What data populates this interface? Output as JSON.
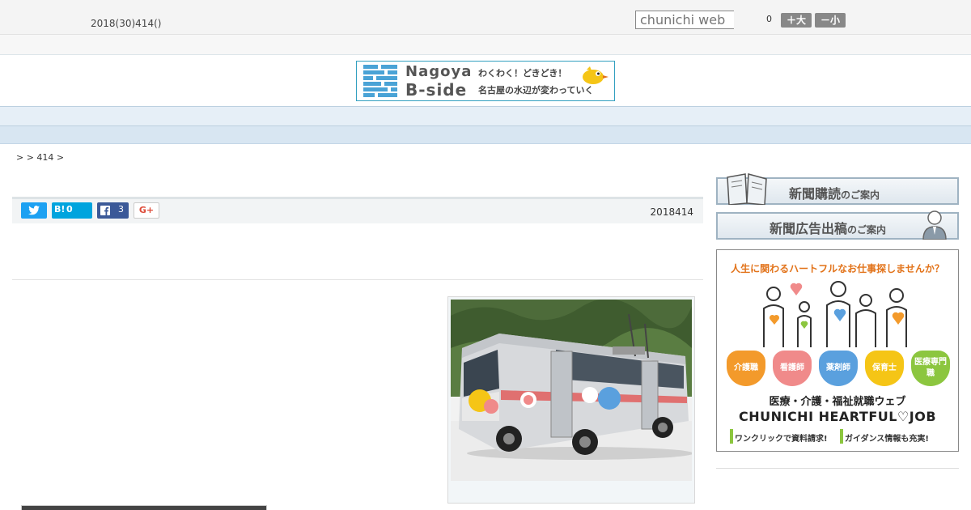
{
  "header": {
    "date": "2018(30)414()",
    "search_placeholder": "chunichi web",
    "font_count": "0",
    "font_bigger": "＋大",
    "font_smaller": "－小"
  },
  "banner": {
    "line1": "Nagoya",
    "line2": "B-side",
    "jp_line1": "わくわく！どきどき！",
    "jp_line2": "名古屋の水辺が変わっていく"
  },
  "nav": {
    "items": [
      "",
      "",
      "",
      "",
      "",
      "",
      "",
      "",
      ""
    ]
  },
  "breadcrumb": ">  > 414 >",
  "share": {
    "hatena_label": "B!",
    "hatena_count": "0",
    "facebook_count": "3",
    "google_label": "G+",
    "article_date": "2018414"
  },
  "sidebar": {
    "subscribe_main": "新聞購読",
    "subscribe_sub": "のご案内",
    "advertise_main": "新聞広告出稿",
    "advertise_sub": "のご案内",
    "ad": {
      "headline": "人生に関わるハートフルなお仕事探しませんか？",
      "hearts": [
        {
          "label": "介護職",
          "color": "#f39a2b"
        },
        {
          "label": "看護師",
          "color": "#f08a8a"
        },
        {
          "label": "薬剤師",
          "color": "#5aa0de"
        },
        {
          "label": "保育士",
          "color": "#f5c516"
        },
        {
          "label": "医療専門職",
          "color": "#8cc63f"
        }
      ],
      "line1": "医療・介護・福祉就職ウェブ",
      "line2": "CHUNICHI HEARTFUL♡JOB",
      "line3": "ワンクリックで資料請求!",
      "line4": "ガイダンス情報も充実!"
    }
  }
}
